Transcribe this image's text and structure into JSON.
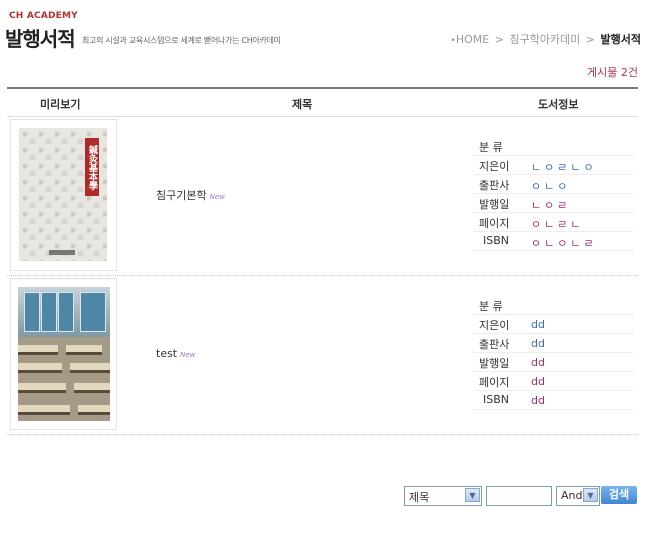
{
  "header": {
    "academy": "CH ACADEMY",
    "title": "발행서적",
    "subtitle": "최고의 시설과 교육시스템으로 세계로 뻗어나가는 CH아카데미"
  },
  "breadcrumb": {
    "home": "HOME",
    "sep1": ">",
    "section": "침구학아카데미",
    "sep2": ">",
    "current": "발행서적"
  },
  "count_label": "게시물 2건",
  "table": {
    "headers": {
      "preview": "미리보기",
      "title": "제목",
      "info": "도서정보"
    },
    "rows": [
      {
        "title": "침구기본학",
        "new_badge": "New",
        "cover_text": "鍼灸基本學",
        "fields": [
          {
            "label": "분   류",
            "value": ""
          },
          {
            "label": "지은이",
            "value": "ㄴㅇㄹㄴㅇ"
          },
          {
            "label": "출판사",
            "value": "ㅇㄴㅇ"
          },
          {
            "label": "발행일",
            "value": "ㄴㅇㄹ"
          },
          {
            "label": "페이지",
            "value": "ㅇㄴㄹㄴ"
          },
          {
            "label": "ISBN",
            "value": "ㅇㄴㅇㄴㄹ"
          }
        ]
      },
      {
        "title": "test",
        "new_badge": "New",
        "fields": [
          {
            "label": "분   류",
            "value": ""
          },
          {
            "label": "지은이",
            "value": "dd"
          },
          {
            "label": "출판사",
            "value": "dd"
          },
          {
            "label": "발행일",
            "value": "dd"
          },
          {
            "label": "페이지",
            "value": "dd"
          },
          {
            "label": "ISBN",
            "value": "dd"
          }
        ]
      }
    ]
  },
  "search": {
    "field_select": "제목",
    "query_value": "",
    "logic_select": "And",
    "button_label": "검색"
  },
  "colors": {
    "accent": "#b0365a",
    "label_blue": "#3a6ea8",
    "value_purple": "#a03070"
  }
}
